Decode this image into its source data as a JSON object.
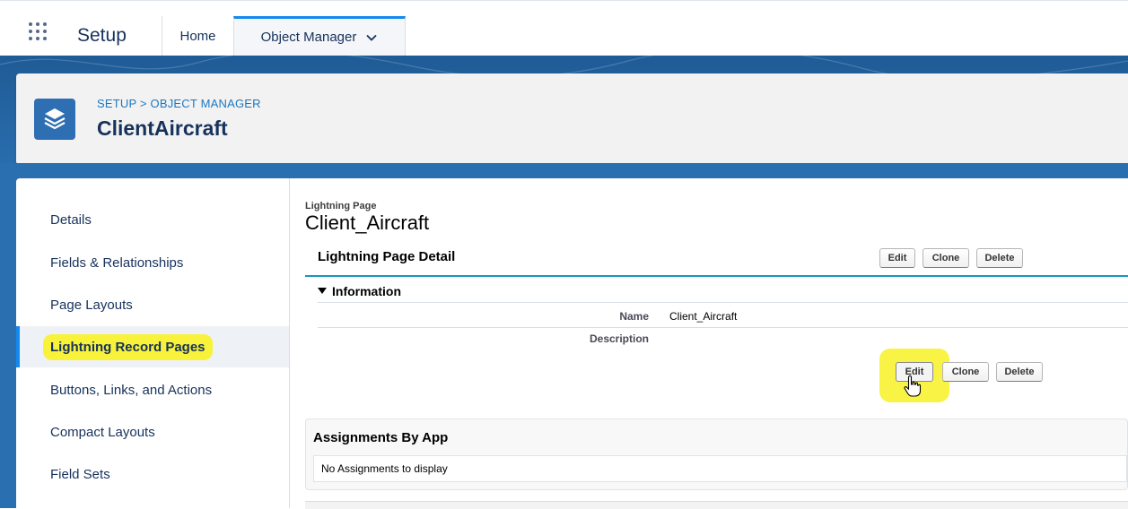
{
  "header": {
    "app_name": "Setup",
    "tabs": [
      {
        "label": "Home"
      },
      {
        "label": "Object Manager"
      }
    ]
  },
  "hero": {
    "breadcrumb": "SETUP > OBJECT MANAGER",
    "object_name": "ClientAircraft"
  },
  "sidebar": {
    "items": [
      {
        "label": "Details"
      },
      {
        "label": "Fields & Relationships"
      },
      {
        "label": "Page Layouts"
      },
      {
        "label": "Lightning Record Pages"
      },
      {
        "label": "Buttons, Links, and Actions"
      },
      {
        "label": "Compact Layouts"
      },
      {
        "label": "Field Sets"
      }
    ],
    "active_index": 3
  },
  "content": {
    "page_type": "Lightning Page",
    "page_name": "Client_Aircraft",
    "detail_title": "Lightning Page Detail",
    "buttons": {
      "edit": "Edit",
      "clone": "Clone",
      "delete": "Delete"
    },
    "section_title": "Information",
    "fields": [
      {
        "label": "Name",
        "value": "Client_Aircraft"
      },
      {
        "label": "Description",
        "value": ""
      }
    ],
    "assignments": {
      "title": "Assignments By App",
      "empty_text": "No Assignments to display"
    }
  },
  "colors": {
    "brand_blue": "#2a6fb0",
    "highlight": "#f8f23a",
    "active_tab_accent": "#1589ee"
  }
}
